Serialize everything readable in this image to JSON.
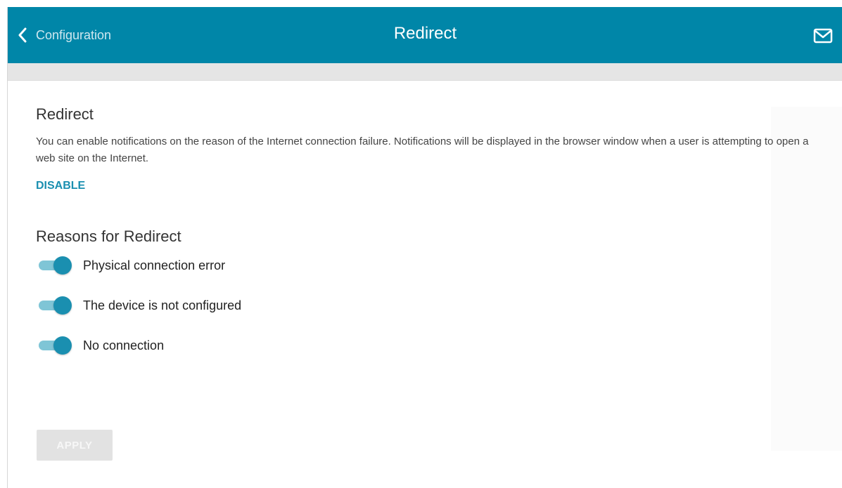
{
  "header": {
    "back_label": "Configuration",
    "title": "Redirect",
    "mail_icon": "mail-icon",
    "back_icon": "chevron-left-icon",
    "background_color": "#0086a8"
  },
  "redirect": {
    "title": "Redirect",
    "description": "You can enable notifications on the reason of the Internet connection failure. Notifications will be displayed in the browser window when a user is attempting to open a web site on the Internet.",
    "disable_label": "DISABLE"
  },
  "reasons": {
    "title": "Reasons for Redirect",
    "items": [
      {
        "label": "Physical connection error",
        "enabled": true
      },
      {
        "label": "The device is not configured",
        "enabled": true
      },
      {
        "label": "No connection",
        "enabled": true
      }
    ]
  },
  "apply_label": "APPLY",
  "colors": {
    "accent": "#1a8fb0",
    "toggle_track": "#7fc5d6",
    "apply_disabled": "#e2e2e2"
  }
}
